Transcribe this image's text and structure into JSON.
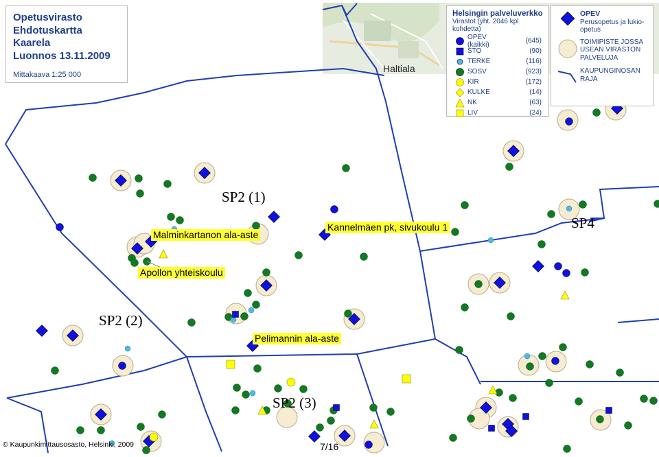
{
  "title_box": {
    "lines": [
      "Opetusvirasto",
      "Ehdotuskartta",
      "Kaarela",
      "Luonnos 13.11.2009"
    ],
    "scale": "Mittakaava 1:25 000"
  },
  "legend": {
    "title": "Helsingin palveluverkko",
    "subtitle": "Virastot (yht. 2046 kpl kohdetta)",
    "items": [
      {
        "label": "OPEV (kaikki)",
        "count": "(645)",
        "symbol": "circle",
        "color": "#1010e0"
      },
      {
        "label": "STO",
        "count": "(90)",
        "symbol": "square",
        "color": "#1010e0"
      },
      {
        "label": "TERKE",
        "count": "(116)",
        "symbol": "small-circle",
        "color": "#4fb8e8"
      },
      {
        "label": "SOSV",
        "count": "(923)",
        "symbol": "circle",
        "color": "#127a22"
      },
      {
        "label": "KIR",
        "count": "(172)",
        "symbol": "circle",
        "color": "#ffff00"
      },
      {
        "label": "KULKE",
        "count": "(14)",
        "symbol": "diamond",
        "color": "#ffff00"
      },
      {
        "label": "NK",
        "count": "(63)",
        "symbol": "triangle",
        "color": "#ffff00"
      },
      {
        "label": "LIV",
        "count": "(24)",
        "symbol": "square",
        "color": "#ffff00"
      }
    ]
  },
  "legend2": {
    "opev_title": "OPEV",
    "opev_desc": "Perusopetus ja lukio-opetus",
    "multi_office": "TOIMIPISTE JOSSA USEAN VIRASTON PALVELUJA",
    "boundary": "KAUPUNGINOSAN RAJA"
  },
  "districts": [
    "SP2 (1)",
    "SP2 (2)",
    "SP2 (3)",
    "SP4"
  ],
  "school_labels": [
    "Malminkartanon ala-aste",
    "Apollon yhteiskoulu",
    "Kannelmäen pk, sivukoulu 1",
    "Pelimannin ala-aste"
  ],
  "place_label": "Haltiala",
  "copyright": "© Kaupunkimittausosasto, Helsinki, 2009",
  "page_number": "7/16",
  "colors": {
    "boundary": "#1f3fb0",
    "opev": "#1010e0",
    "sosv": "#127a22",
    "terke": "#4fb8e8",
    "yellow": "#ffff00",
    "multi_office_fill": "#f6ecd2"
  }
}
